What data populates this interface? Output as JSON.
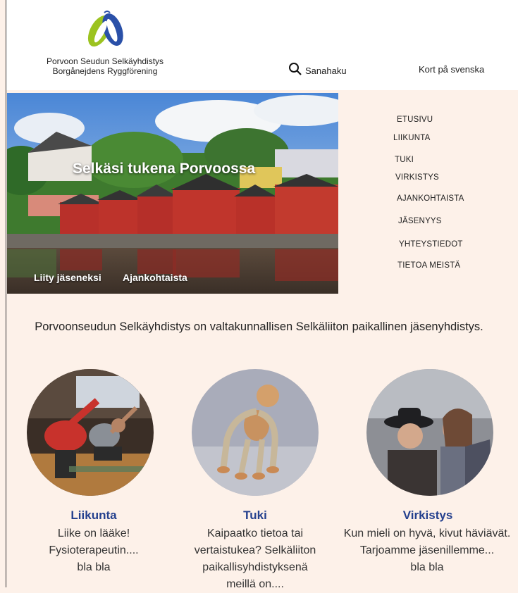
{
  "header": {
    "org_name_fi": "Porvoon Seudun Selkäyhdistys",
    "org_name_sv": "Borgånejdens Ryggförening",
    "search_label": "Sanahaku",
    "swedish_link": "Kort på svenska",
    "logo_colors": {
      "green": "#9cc320",
      "blue": "#2a50a8"
    }
  },
  "hero": {
    "title": "Selkäsi tukena Porvoossa",
    "join_button": "Liity jäseneksi",
    "news_button": "Ajankohtaista"
  },
  "nav": {
    "items": [
      "ETUSIVU",
      "LIIKUNTA",
      "TUKI",
      "VIRKISTYS",
      "AJANKOHTAISTA",
      "JÄSENYYS",
      "YHTEYSTIEDOT",
      "TIETOA MEISTÄ"
    ]
  },
  "intro": "Porvoonseudun Selkäyhdistys on valtakunnallisen Selkäliiton paikallinen jäsenyhdistys.",
  "cards": [
    {
      "title": "Liikunta",
      "lines": [
        "Liike on lääke!",
        "Fysioterapeutin....",
        "bla bla"
      ]
    },
    {
      "title": "Tuki",
      "lines": [
        "Kaipaatko tietoa tai",
        "vertaistukea? Selkäliiton",
        "paikallisyhdistyksenä",
        "meillä on...."
      ]
    },
    {
      "title": "Virkistys",
      "lines": [
        "Kun mieli on hyvä, kivut häviävät.",
        "Tarjoamme  jäsenillemme...",
        "bla bla"
      ]
    }
  ],
  "colors": {
    "background": "#fdf1e9",
    "card_title": "#24408e"
  }
}
